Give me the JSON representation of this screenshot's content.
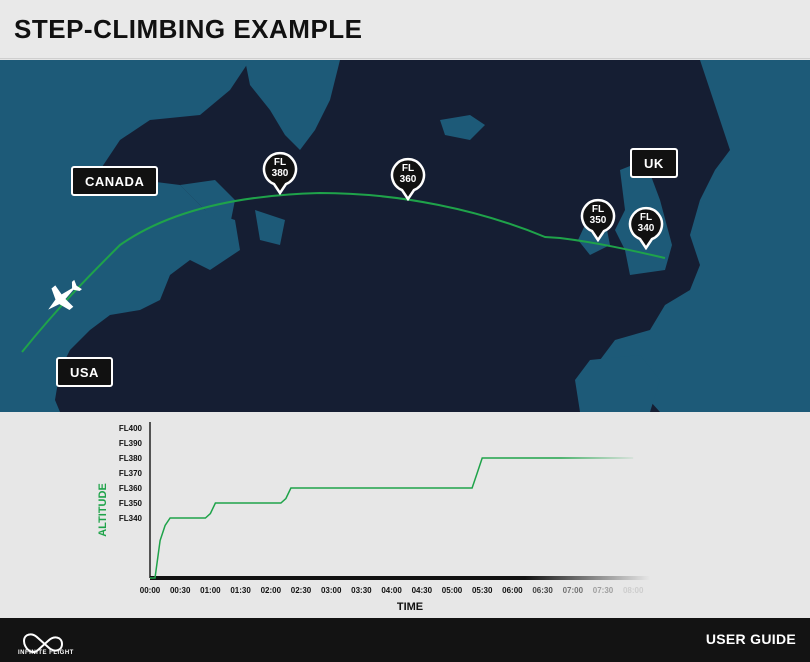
{
  "header": {
    "title": "STEP-CLIMBING EXAMPLE"
  },
  "map": {
    "labels": {
      "canada": "CANADA",
      "usa": "USA",
      "uk": "UK"
    },
    "pins": [
      {
        "line1": "FL",
        "line2": "380"
      },
      {
        "line1": "FL",
        "line2": "360"
      },
      {
        "line1": "FL",
        "line2": "350"
      },
      {
        "line1": "FL",
        "line2": "340"
      }
    ],
    "route_color": "#1fa34a"
  },
  "chart_data": {
    "type": "line",
    "ylabel": "ALTITUDE",
    "xlabel": "TIME",
    "y_ticks": [
      "FL400",
      "FL390",
      "FL380",
      "FL370",
      "FL360",
      "FL350",
      "FL340"
    ],
    "x_ticks": [
      "00:00",
      "00:30",
      "01:00",
      "01:30",
      "02:00",
      "02:30",
      "03:00",
      "03:30",
      "04:00",
      "04:30",
      "05:00",
      "05:30",
      "06:00",
      "06:30",
      "07:00",
      "07:30",
      "08:00"
    ],
    "series": [
      {
        "x": [
          "00:00",
          "00:05",
          "00:10",
          "00:15",
          "00:20",
          "00:30",
          "00:55",
          "01:00",
          "01:05",
          "02:10",
          "02:15",
          "02:20",
          "05:20",
          "05:25",
          "05:30",
          "08:00"
        ],
        "y": [
          0,
          300,
          325,
          335,
          340,
          340,
          340,
          343,
          350,
          350,
          353,
          360,
          360,
          370,
          380,
          380
        ]
      }
    ],
    "color": "#1fa34a"
  },
  "footer": {
    "brand": "INFINITE FLIGHT",
    "guide": "USER GUIDE"
  }
}
